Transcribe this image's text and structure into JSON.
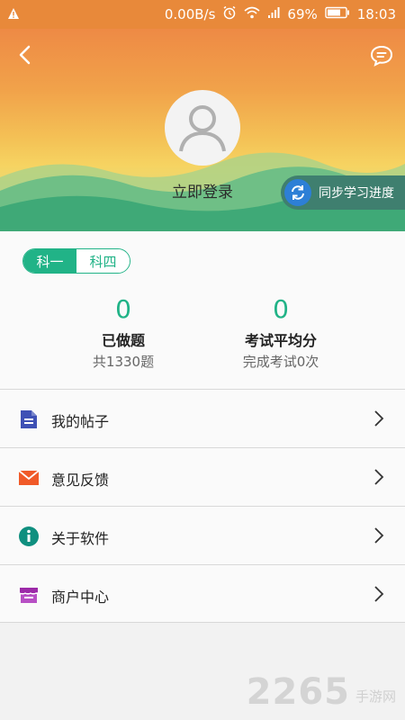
{
  "status_bar": {
    "network_speed": "0.00B/s",
    "battery": "69%",
    "time": "18:03"
  },
  "header": {
    "login_text": "立即登录",
    "sync_label": "同步学习进度"
  },
  "subject_toggle": [
    "科一",
    "科四"
  ],
  "stats": {
    "done": {
      "value": "0",
      "label": "已做题",
      "sub": "共1330题"
    },
    "exam": {
      "value": "0",
      "label": "考试平均分",
      "sub": "完成考试0次"
    }
  },
  "menu": [
    {
      "label": "我的帖子",
      "icon": "document-icon",
      "color": "#3f51b5"
    },
    {
      "label": "意见反馈",
      "icon": "mail-icon",
      "color": "#f05a28"
    },
    {
      "label": "关于软件",
      "icon": "info-icon",
      "color": "#0f8f7f"
    },
    {
      "label": "商户中心",
      "icon": "store-icon",
      "color": "#9c2aa8"
    }
  ],
  "watermark": {
    "number": "2265",
    "suffix": "手游网"
  },
  "colors": {
    "accent": "#21b387",
    "header_top": "#ee8a45"
  }
}
